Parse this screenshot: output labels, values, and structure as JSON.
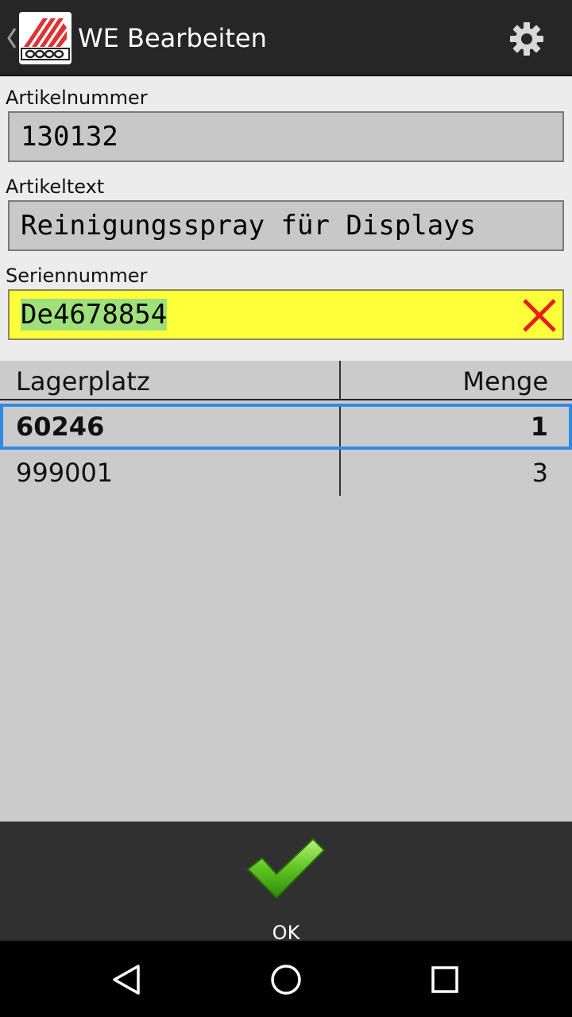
{
  "app": {
    "title": "WE Bearbeiten",
    "logo_icon": "company-logo",
    "accent": "#2e8ce6"
  },
  "form": {
    "artikelnummer": {
      "label": "Artikelnummer",
      "value": "130132"
    },
    "artikeltext": {
      "label": "Artikeltext",
      "value": "Reinigungsspray für Displays"
    },
    "seriennummer": {
      "label": "Seriennummer",
      "value": "De4678854",
      "highlight": "#ffff3a"
    }
  },
  "table": {
    "columns": [
      "Lagerplatz",
      "Menge"
    ],
    "rows": [
      {
        "lagerplatz": "60246",
        "menge": "1",
        "selected": true
      },
      {
        "lagerplatz": "999001",
        "menge": "3",
        "selected": false
      }
    ]
  },
  "actions": {
    "ok_label": "OK",
    "ok_icon": "checkmark-icon"
  },
  "navigation": {
    "back_icon": "back-triangle-icon",
    "home_icon": "home-circle-icon",
    "recents_icon": "recents-square-icon"
  }
}
